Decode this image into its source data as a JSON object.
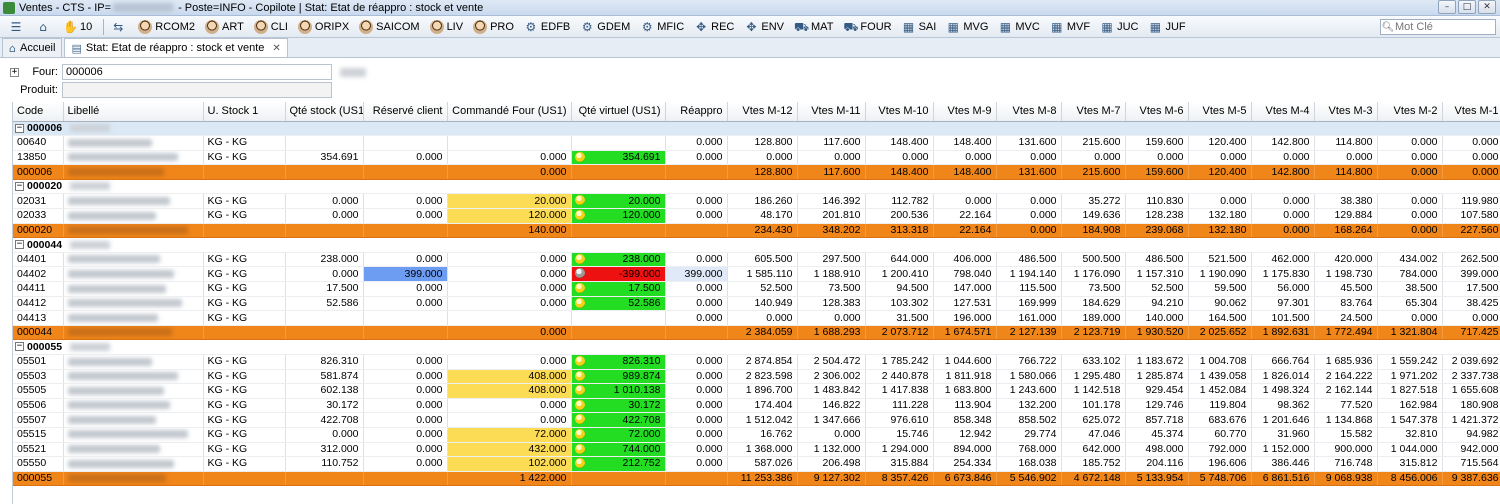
{
  "window": {
    "title_prefix": "Ventes - CTS - IP=",
    "title_suffix": " - Poste=INFO - Copilote | Stat: Etat de réappro : stock et vente"
  },
  "toolbar": {
    "count": "10",
    "items": [
      {
        "label": "RCOM2",
        "icon": "user-face-icon"
      },
      {
        "label": "ART",
        "icon": "user-face-icon"
      },
      {
        "label": "CLI",
        "icon": "user-face-icon"
      },
      {
        "label": "ORIPX",
        "icon": "user-face-icon"
      },
      {
        "label": "SAICOM",
        "icon": "user-face-icon"
      },
      {
        "label": "LIV",
        "icon": "user-face-icon"
      },
      {
        "label": "PRO",
        "icon": "user-face-icon"
      },
      {
        "label": "EDFB",
        "icon": "gear-icon"
      },
      {
        "label": "GDEM",
        "icon": "gear-icon"
      },
      {
        "label": "MFIC",
        "icon": "gear-icon"
      },
      {
        "label": "REC",
        "icon": "arrows-icon"
      },
      {
        "label": "ENV",
        "icon": "arrows-icon"
      },
      {
        "label": "MAT",
        "icon": "truck-icon"
      },
      {
        "label": "FOUR",
        "icon": "truck-icon"
      },
      {
        "label": "SAI",
        "icon": "chart-icon"
      },
      {
        "label": "MVG",
        "icon": "chart-icon"
      },
      {
        "label": "MVC",
        "icon": "chart-icon"
      },
      {
        "label": "MVF",
        "icon": "chart-icon"
      },
      {
        "label": "JUC",
        "icon": "chart-icon"
      },
      {
        "label": "JUF",
        "icon": "chart-icon"
      }
    ],
    "search_placeholder": "Mot Clé"
  },
  "tabs": [
    {
      "label": "Accueil",
      "icon": "home-icon"
    },
    {
      "label": "Stat: Etat de réappro : stock et vente",
      "icon": "chart-icon",
      "active": true
    }
  ],
  "filters": {
    "four_label": "Four:",
    "four_value": "000006",
    "produit_label": "Produit:",
    "produit_value": ""
  },
  "columns": [
    "Code",
    "Libellé",
    "U. Stock 1",
    "Qté stock (US1)",
    "Réservé client",
    "Commandé Four (US1)",
    "Qté virtuel (US1)",
    "Réappro",
    "Vtes M-12",
    "Vtes M-11",
    "Vtes M-10",
    "Vtes M-9",
    "Vtes M-8",
    "Vtes M-7",
    "Vtes M-6",
    "Vtes M-5",
    "Vtes M-4",
    "Vtes M-3",
    "Vtes M-2",
    "Vtes M-1"
  ],
  "rows": [
    {
      "type": "group",
      "code": "000006"
    },
    {
      "type": "item",
      "code": "00640",
      "unit": "KG - KG",
      "stock": "",
      "reserve": "",
      "cmd": "",
      "virt": "",
      "reappro": "0.000",
      "sales": [
        "128.800",
        "117.600",
        "148.400",
        "148.400",
        "131.600",
        "215.600",
        "159.600",
        "120.400",
        "142.800",
        "114.800",
        "0.000",
        "0.000"
      ]
    },
    {
      "type": "item",
      "code": "13850",
      "unit": "KG - KG",
      "stock": "354.691",
      "reserve": "0.000",
      "cmd": "0.000",
      "virt": "354.691",
      "virt_color": "green",
      "reappro": "0.000",
      "sales": [
        "0.000",
        "0.000",
        "0.000",
        "0.000",
        "0.000",
        "0.000",
        "0.000",
        "0.000",
        "0.000",
        "0.000",
        "0.000",
        "0.000"
      ]
    },
    {
      "type": "total",
      "code": "000006",
      "cmd": "0.000",
      "sales": [
        "128.800",
        "117.600",
        "148.400",
        "148.400",
        "131.600",
        "215.600",
        "159.600",
        "120.400",
        "142.800",
        "114.800",
        "0.000",
        "0.000"
      ]
    },
    {
      "type": "group",
      "code": "000020"
    },
    {
      "type": "item",
      "code": "02031",
      "unit": "KG - KG",
      "stock": "0.000",
      "reserve": "0.000",
      "cmd": "20.000",
      "cmd_color": "yellow",
      "virt": "20.000",
      "virt_color": "green",
      "reappro": "0.000",
      "sales": [
        "186.260",
        "146.392",
        "112.782",
        "0.000",
        "0.000",
        "35.272",
        "110.830",
        "0.000",
        "0.000",
        "38.380",
        "0.000",
        "119.980"
      ]
    },
    {
      "type": "item",
      "code": "02033",
      "unit": "KG - KG",
      "stock": "0.000",
      "reserve": "0.000",
      "cmd": "120.000",
      "cmd_color": "yellow",
      "virt": "120.000",
      "virt_color": "green",
      "reappro": "0.000",
      "sales": [
        "48.170",
        "201.810",
        "200.536",
        "22.164",
        "0.000",
        "149.636",
        "128.238",
        "132.180",
        "0.000",
        "129.884",
        "0.000",
        "107.580"
      ]
    },
    {
      "type": "total",
      "code": "000020",
      "cmd": "140.000",
      "sales": [
        "234.430",
        "348.202",
        "313.318",
        "22.164",
        "0.000",
        "184.908",
        "239.068",
        "132.180",
        "0.000",
        "168.264",
        "0.000",
        "227.560"
      ]
    },
    {
      "type": "group",
      "code": "000044"
    },
    {
      "type": "item",
      "code": "04401",
      "unit": "KG - KG",
      "stock": "238.000",
      "reserve": "0.000",
      "cmd": "0.000",
      "virt": "238.000",
      "virt_color": "green",
      "reappro": "0.000",
      "sales": [
        "605.500",
        "297.500",
        "644.000",
        "406.000",
        "486.500",
        "500.500",
        "486.500",
        "521.500",
        "462.000",
        "420.000",
        "434.002",
        "262.500"
      ]
    },
    {
      "type": "item",
      "code": "04402",
      "unit": "KG - KG",
      "stock": "0.000",
      "reserve": "399.000",
      "reserve_color": "blue",
      "cmd": "0.000",
      "virt": "-399.000",
      "virt_color": "red",
      "reappro": "399.000",
      "reappro_color": "lightblue",
      "sales": [
        "1 585.110",
        "1 188.910",
        "1 200.410",
        "798.040",
        "1 194.140",
        "1 176.090",
        "1 157.310",
        "1 190.090",
        "1 175.830",
        "1 198.730",
        "784.000",
        "399.000"
      ]
    },
    {
      "type": "item",
      "code": "04411",
      "unit": "KG - KG",
      "stock": "17.500",
      "reserve": "0.000",
      "cmd": "0.000",
      "virt": "17.500",
      "virt_color": "green",
      "reappro": "0.000",
      "sales": [
        "52.500",
        "73.500",
        "94.500",
        "147.000",
        "115.500",
        "73.500",
        "52.500",
        "59.500",
        "56.000",
        "45.500",
        "38.500",
        "17.500"
      ]
    },
    {
      "type": "item",
      "code": "04412",
      "unit": "KG - KG",
      "stock": "52.586",
      "reserve": "0.000",
      "cmd": "0.000",
      "virt": "52.586",
      "virt_color": "green",
      "reappro": "0.000",
      "sales": [
        "140.949",
        "128.383",
        "103.302",
        "127.531",
        "169.999",
        "184.629",
        "94.210",
        "90.062",
        "97.301",
        "83.764",
        "65.304",
        "38.425"
      ]
    },
    {
      "type": "item",
      "code": "04413",
      "unit": "KG - KG",
      "stock": "",
      "reserve": "",
      "cmd": "",
      "virt": "",
      "reappro": "0.000",
      "sales": [
        "0.000",
        "0.000",
        "31.500",
        "196.000",
        "161.000",
        "189.000",
        "140.000",
        "164.500",
        "101.500",
        "24.500",
        "0.000",
        "0.000"
      ]
    },
    {
      "type": "total",
      "code": "000044",
      "cmd": "0.000",
      "sales": [
        "2 384.059",
        "1 688.293",
        "2 073.712",
        "1 674.571",
        "2 127.139",
        "2 123.719",
        "1 930.520",
        "2 025.652",
        "1 892.631",
        "1 772.494",
        "1 321.804",
        "717.425"
      ]
    },
    {
      "type": "group",
      "code": "000055"
    },
    {
      "type": "item",
      "code": "05501",
      "unit": "KG - KG",
      "stock": "826.310",
      "reserve": "0.000",
      "cmd": "0.000",
      "virt": "826.310",
      "virt_color": "green",
      "reappro": "0.000",
      "sales": [
        "2 874.854",
        "2 504.472",
        "1 785.242",
        "1 044.600",
        "766.722",
        "633.102",
        "1 183.672",
        "1 004.708",
        "666.764",
        "1 685.936",
        "1 559.242",
        "2 039.692"
      ]
    },
    {
      "type": "item",
      "code": "05503",
      "unit": "KG - KG",
      "stock": "581.874",
      "reserve": "0.000",
      "cmd": "408.000",
      "cmd_color": "yellow",
      "virt": "989.874",
      "virt_color": "green",
      "reappro": "0.000",
      "sales": [
        "2 823.598",
        "2 306.002",
        "2 440.878",
        "1 811.918",
        "1 580.066",
        "1 295.480",
        "1 285.874",
        "1 439.058",
        "1 826.014",
        "2 164.222",
        "1 971.202",
        "2 337.738"
      ]
    },
    {
      "type": "item",
      "code": "05505",
      "unit": "KG - KG",
      "stock": "602.138",
      "reserve": "0.000",
      "cmd": "408.000",
      "cmd_color": "yellow",
      "virt": "1 010.138",
      "virt_color": "green",
      "reappro": "0.000",
      "sales": [
        "1 896.700",
        "1 483.842",
        "1 417.838",
        "1 683.800",
        "1 243.600",
        "1 142.518",
        "929.454",
        "1 452.084",
        "1 498.324",
        "2 162.144",
        "1 827.518",
        "1 655.608"
      ]
    },
    {
      "type": "item",
      "code": "05506",
      "unit": "KG - KG",
      "stock": "30.172",
      "reserve": "0.000",
      "cmd": "0.000",
      "virt": "30.172",
      "virt_color": "green",
      "reappro": "0.000",
      "sales": [
        "174.404",
        "146.822",
        "111.228",
        "113.904",
        "132.200",
        "101.178",
        "129.746",
        "119.804",
        "98.362",
        "77.520",
        "162.984",
        "180.908"
      ]
    },
    {
      "type": "item",
      "code": "05507",
      "unit": "KG - KG",
      "stock": "422.708",
      "reserve": "0.000",
      "cmd": "0.000",
      "virt": "422.708",
      "virt_color": "green",
      "reappro": "0.000",
      "sales": [
        "1 512.042",
        "1 347.666",
        "976.610",
        "858.348",
        "858.502",
        "625.072",
        "857.718",
        "683.676",
        "1 201.646",
        "1 134.868",
        "1 547.378",
        "1 421.372"
      ]
    },
    {
      "type": "item",
      "code": "05515",
      "unit": "KG - KG",
      "stock": "0.000",
      "reserve": "0.000",
      "cmd": "72.000",
      "cmd_color": "yellow",
      "virt": "72.000",
      "virt_color": "green",
      "reappro": "0.000",
      "sales": [
        "16.762",
        "0.000",
        "15.746",
        "12.942",
        "29.774",
        "47.046",
        "45.374",
        "60.770",
        "31.960",
        "15.582",
        "32.810",
        "94.982"
      ]
    },
    {
      "type": "item",
      "code": "05521",
      "unit": "KG - KG",
      "stock": "312.000",
      "reserve": "0.000",
      "cmd": "432.000",
      "cmd_color": "yellow",
      "virt": "744.000",
      "virt_color": "green",
      "reappro": "0.000",
      "sales": [
        "1 368.000",
        "1 132.000",
        "1 294.000",
        "894.000",
        "768.000",
        "642.000",
        "498.000",
        "792.000",
        "1 152.000",
        "900.000",
        "1 044.000",
        "942.000"
      ]
    },
    {
      "type": "item",
      "code": "05550",
      "unit": "KG - KG",
      "stock": "110.752",
      "reserve": "0.000",
      "cmd": "102.000",
      "cmd_color": "yellow",
      "virt": "212.752",
      "virt_color": "green",
      "reappro": "0.000",
      "sales": [
        "587.026",
        "206.498",
        "315.884",
        "254.334",
        "168.038",
        "185.752",
        "204.116",
        "196.606",
        "386.446",
        "716.748",
        "315.812",
        "715.564"
      ]
    },
    {
      "type": "total",
      "code": "000055",
      "cmd": "1 422.000",
      "sales": [
        "11 253.386",
        "9 127.302",
        "8 357.426",
        "6 673.846",
        "5 546.902",
        "4 672.148",
        "5 133.954",
        "5 748.706",
        "6 861.516",
        "9 068.938",
        "8 456.006",
        "9 387.636"
      ]
    }
  ]
}
